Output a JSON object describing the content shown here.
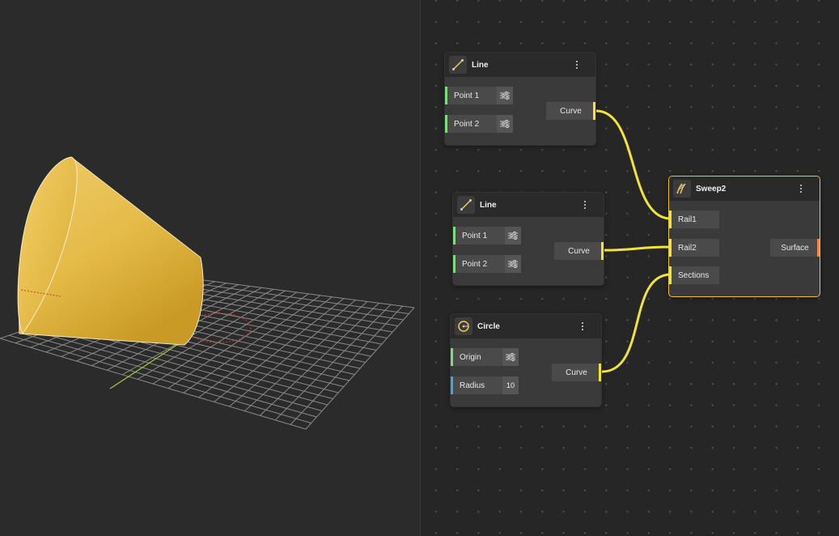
{
  "colors": {
    "wire": "#f2e33a",
    "point_port": "#7ddc7d",
    "number_port": "#3fa7e0",
    "surface_port": "#f08a40",
    "selected": "#e8c53a",
    "cone": "#e7bd4a"
  },
  "nodes": {
    "line1": {
      "title": "Line",
      "icon": "line-icon",
      "inputs": [
        {
          "label": "Point 1"
        },
        {
          "label": "Point 2"
        }
      ],
      "output": "Curve"
    },
    "line2": {
      "title": "Line",
      "icon": "line-icon",
      "inputs": [
        {
          "label": "Point 1"
        },
        {
          "label": "Point 2"
        }
      ],
      "output": "Curve"
    },
    "circle": {
      "title": "Circle",
      "icon": "circle-icon",
      "inputs": [
        {
          "label": "Origin"
        },
        {
          "label": "Radius",
          "value": "10"
        }
      ],
      "output": "Curve"
    },
    "sweep": {
      "title": "Sweep2",
      "icon": "sweep-icon",
      "inputs": [
        {
          "label": "Rail1"
        },
        {
          "label": "Rail2"
        },
        {
          "label": "Sections"
        }
      ],
      "output": "Surface"
    }
  }
}
